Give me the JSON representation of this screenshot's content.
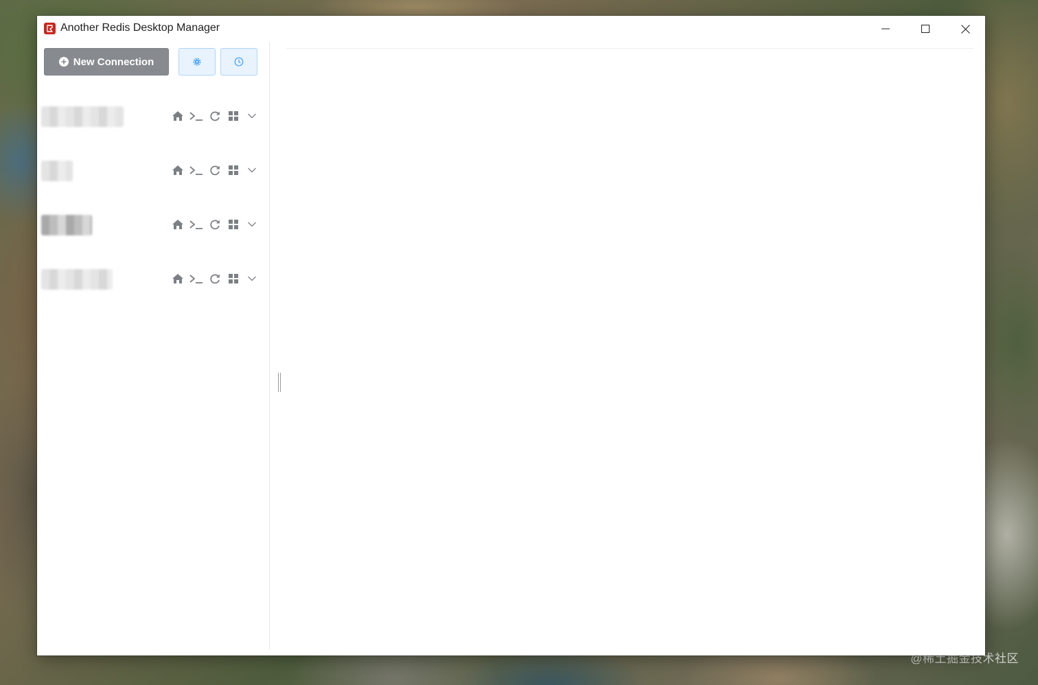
{
  "window": {
    "title": "Another Redis Desktop Manager"
  },
  "toolbar": {
    "new_connection_label": "New Connection"
  },
  "connections": [
    {
      "name": ""
    },
    {
      "name": ""
    },
    {
      "name": ""
    },
    {
      "name": ""
    }
  ],
  "watermark": "@稀土掘金技术社区",
  "colors": {
    "accent": "#409eff",
    "new_button_bg": "#878a8f",
    "light_button_bg": "#e8f3fe",
    "icon_gray": "#7c7f84",
    "app_icon_red": "#c8271f"
  },
  "icons": {
    "app": "redis-app-icon",
    "new_connection": "plus-circle-icon",
    "settings": "gear-icon",
    "history": "clock-icon",
    "connection_actions": [
      "home-icon",
      "terminal-icon",
      "refresh-icon",
      "grid-icon",
      "chevron-down-icon"
    ]
  }
}
